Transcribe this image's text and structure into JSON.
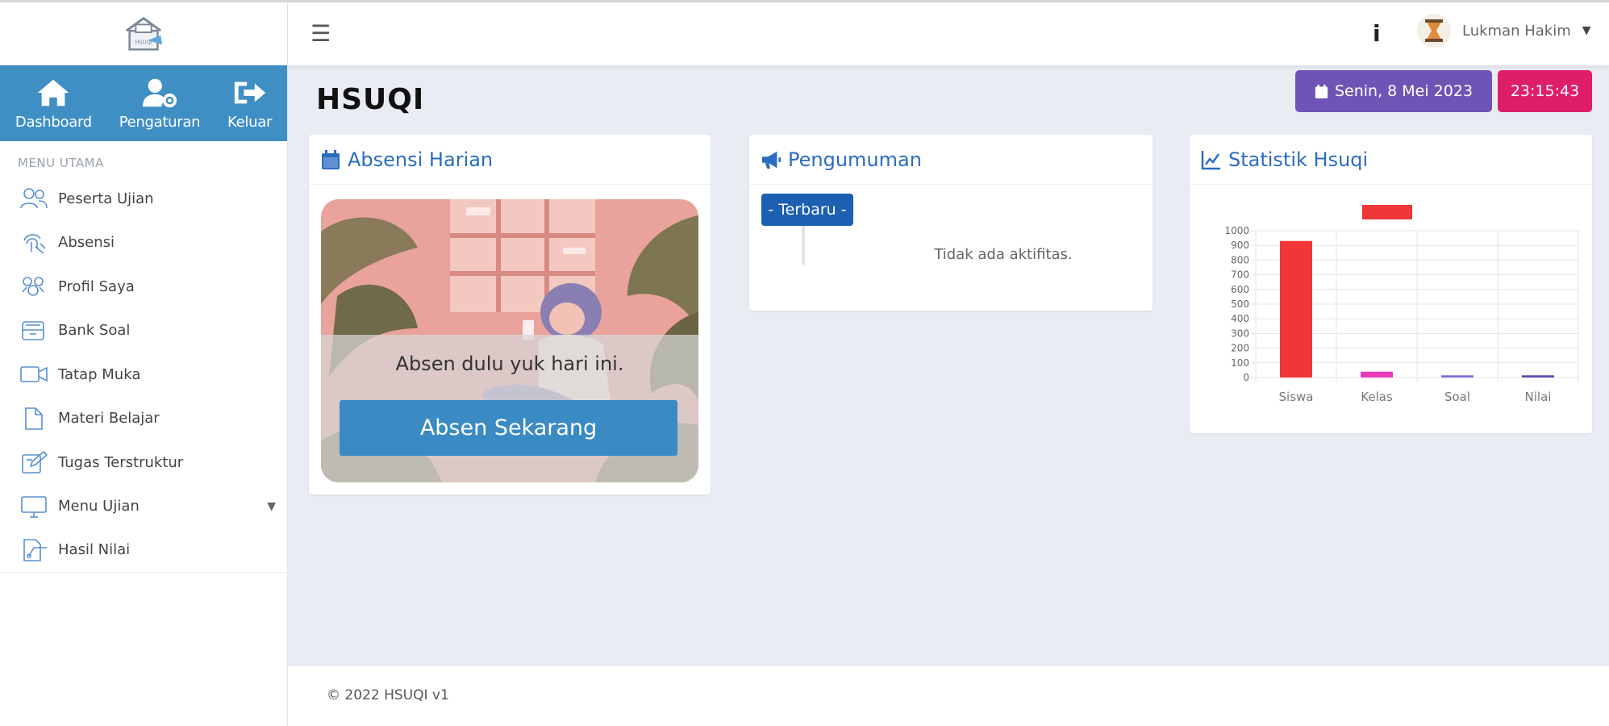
{
  "sidebar": {
    "quick_actions": [
      {
        "label": "Dashboard",
        "icon": "home-icon"
      },
      {
        "label": "Pengaturan",
        "icon": "user-settings-icon"
      },
      {
        "label": "Keluar",
        "icon": "logout-icon"
      }
    ],
    "menu_header": "MENU UTAMA",
    "items": [
      {
        "label": "Peserta Ujian",
        "icon": "users-icon"
      },
      {
        "label": "Absensi",
        "icon": "fingerprint-icon"
      },
      {
        "label": "Profil Saya",
        "icon": "profile-icon"
      },
      {
        "label": "Bank Soal",
        "icon": "archive-icon"
      },
      {
        "label": "Tatap Muka",
        "icon": "video-icon"
      },
      {
        "label": "Materi Belajar",
        "icon": "file-icon"
      },
      {
        "label": "Tugas Terstruktur",
        "icon": "edit-icon"
      },
      {
        "label": "Menu Ujian",
        "icon": "monitor-icon"
      },
      {
        "label": "Hasil Nilai",
        "icon": "report-icon"
      }
    ]
  },
  "navbar": {
    "user_name": "Lukman Hakim",
    "info_icon": "info-icon"
  },
  "page": {
    "title": "HSUQI",
    "date": "Senin, 8 Mei 2023",
    "time": "23:15:43"
  },
  "absensi": {
    "title": "Absensi Harian",
    "prompt": "Absen dulu yuk hari ini.",
    "button": "Absen Sekarang"
  },
  "pengumuman": {
    "title": "Pengumuman",
    "badge": "- Terbaru -",
    "empty": "Tidak ada aktifitas."
  },
  "statistik": {
    "title": "Statistik Hsuqi"
  },
  "chart_data": {
    "type": "bar",
    "categories": [
      "Siswa",
      "Kelas",
      "Soal",
      "Nilai"
    ],
    "values": [
      930,
      40,
      15,
      15
    ],
    "bar_colors": [
      "#ef3737",
      "#e83ab9",
      "#7b6fd6",
      "#5a4fb0"
    ],
    "legend_color": "#ef3737",
    "ylim": [
      0,
      1000
    ],
    "yticks": [
      0,
      100,
      200,
      300,
      400,
      500,
      600,
      700,
      800,
      900,
      1000
    ],
    "grid": true,
    "legend_position": "top"
  },
  "footer": {
    "text": "© 2022 HSUQI v1"
  },
  "colors": {
    "sidebar_accent": "#3f8fc4",
    "link_blue": "#2a6cc0",
    "date_badge": "#6f54b5",
    "time_badge": "#df1e6b",
    "button_blue": "#3a8ac4"
  }
}
